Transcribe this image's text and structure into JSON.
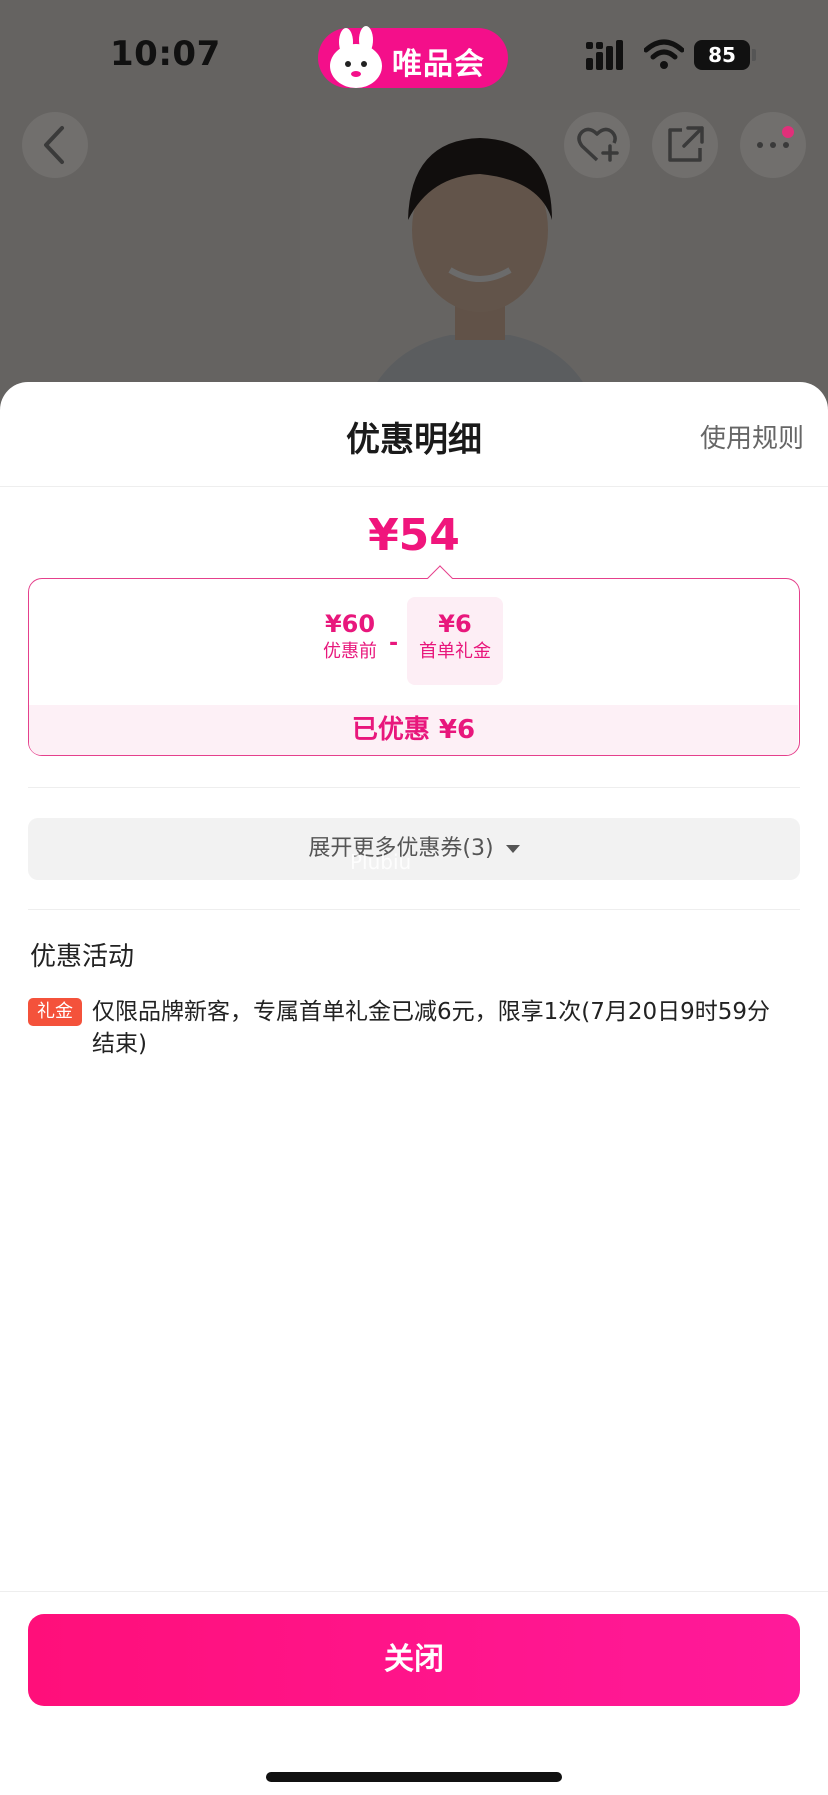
{
  "status_bar": {
    "time": "10:07",
    "app_name": "唯品会",
    "battery": "85",
    "accent": "#f40f8a"
  },
  "nav_icons": [
    "back-arrow-icon",
    "favorite-add-icon",
    "share-icon",
    "more-icon"
  ],
  "sheet": {
    "title": "优惠明细",
    "rules_link": "使用规则",
    "final_price": "¥54",
    "calc": {
      "original_amount": "¥60",
      "original_label": "优惠前",
      "minus": "-",
      "coupon_amount": "¥6",
      "coupon_label": "首单礼金",
      "saved_text": "已优惠 ¥6"
    },
    "expand_label": "展开更多优惠券(3)",
    "watermark": "Plubiu",
    "activity_section_title": "优惠活动",
    "activity": {
      "tag": "礼金",
      "text": "仅限品牌新客，专属首单礼金已减6元，限享1次(7月20日9时59分结束)"
    },
    "close_label": "关闭"
  },
  "colors": {
    "price_pink": "#f0157c",
    "tag_red": "#f4523b",
    "button_gradient_start": "#ff0f7a",
    "button_gradient_end": "#ff1a9a"
  }
}
